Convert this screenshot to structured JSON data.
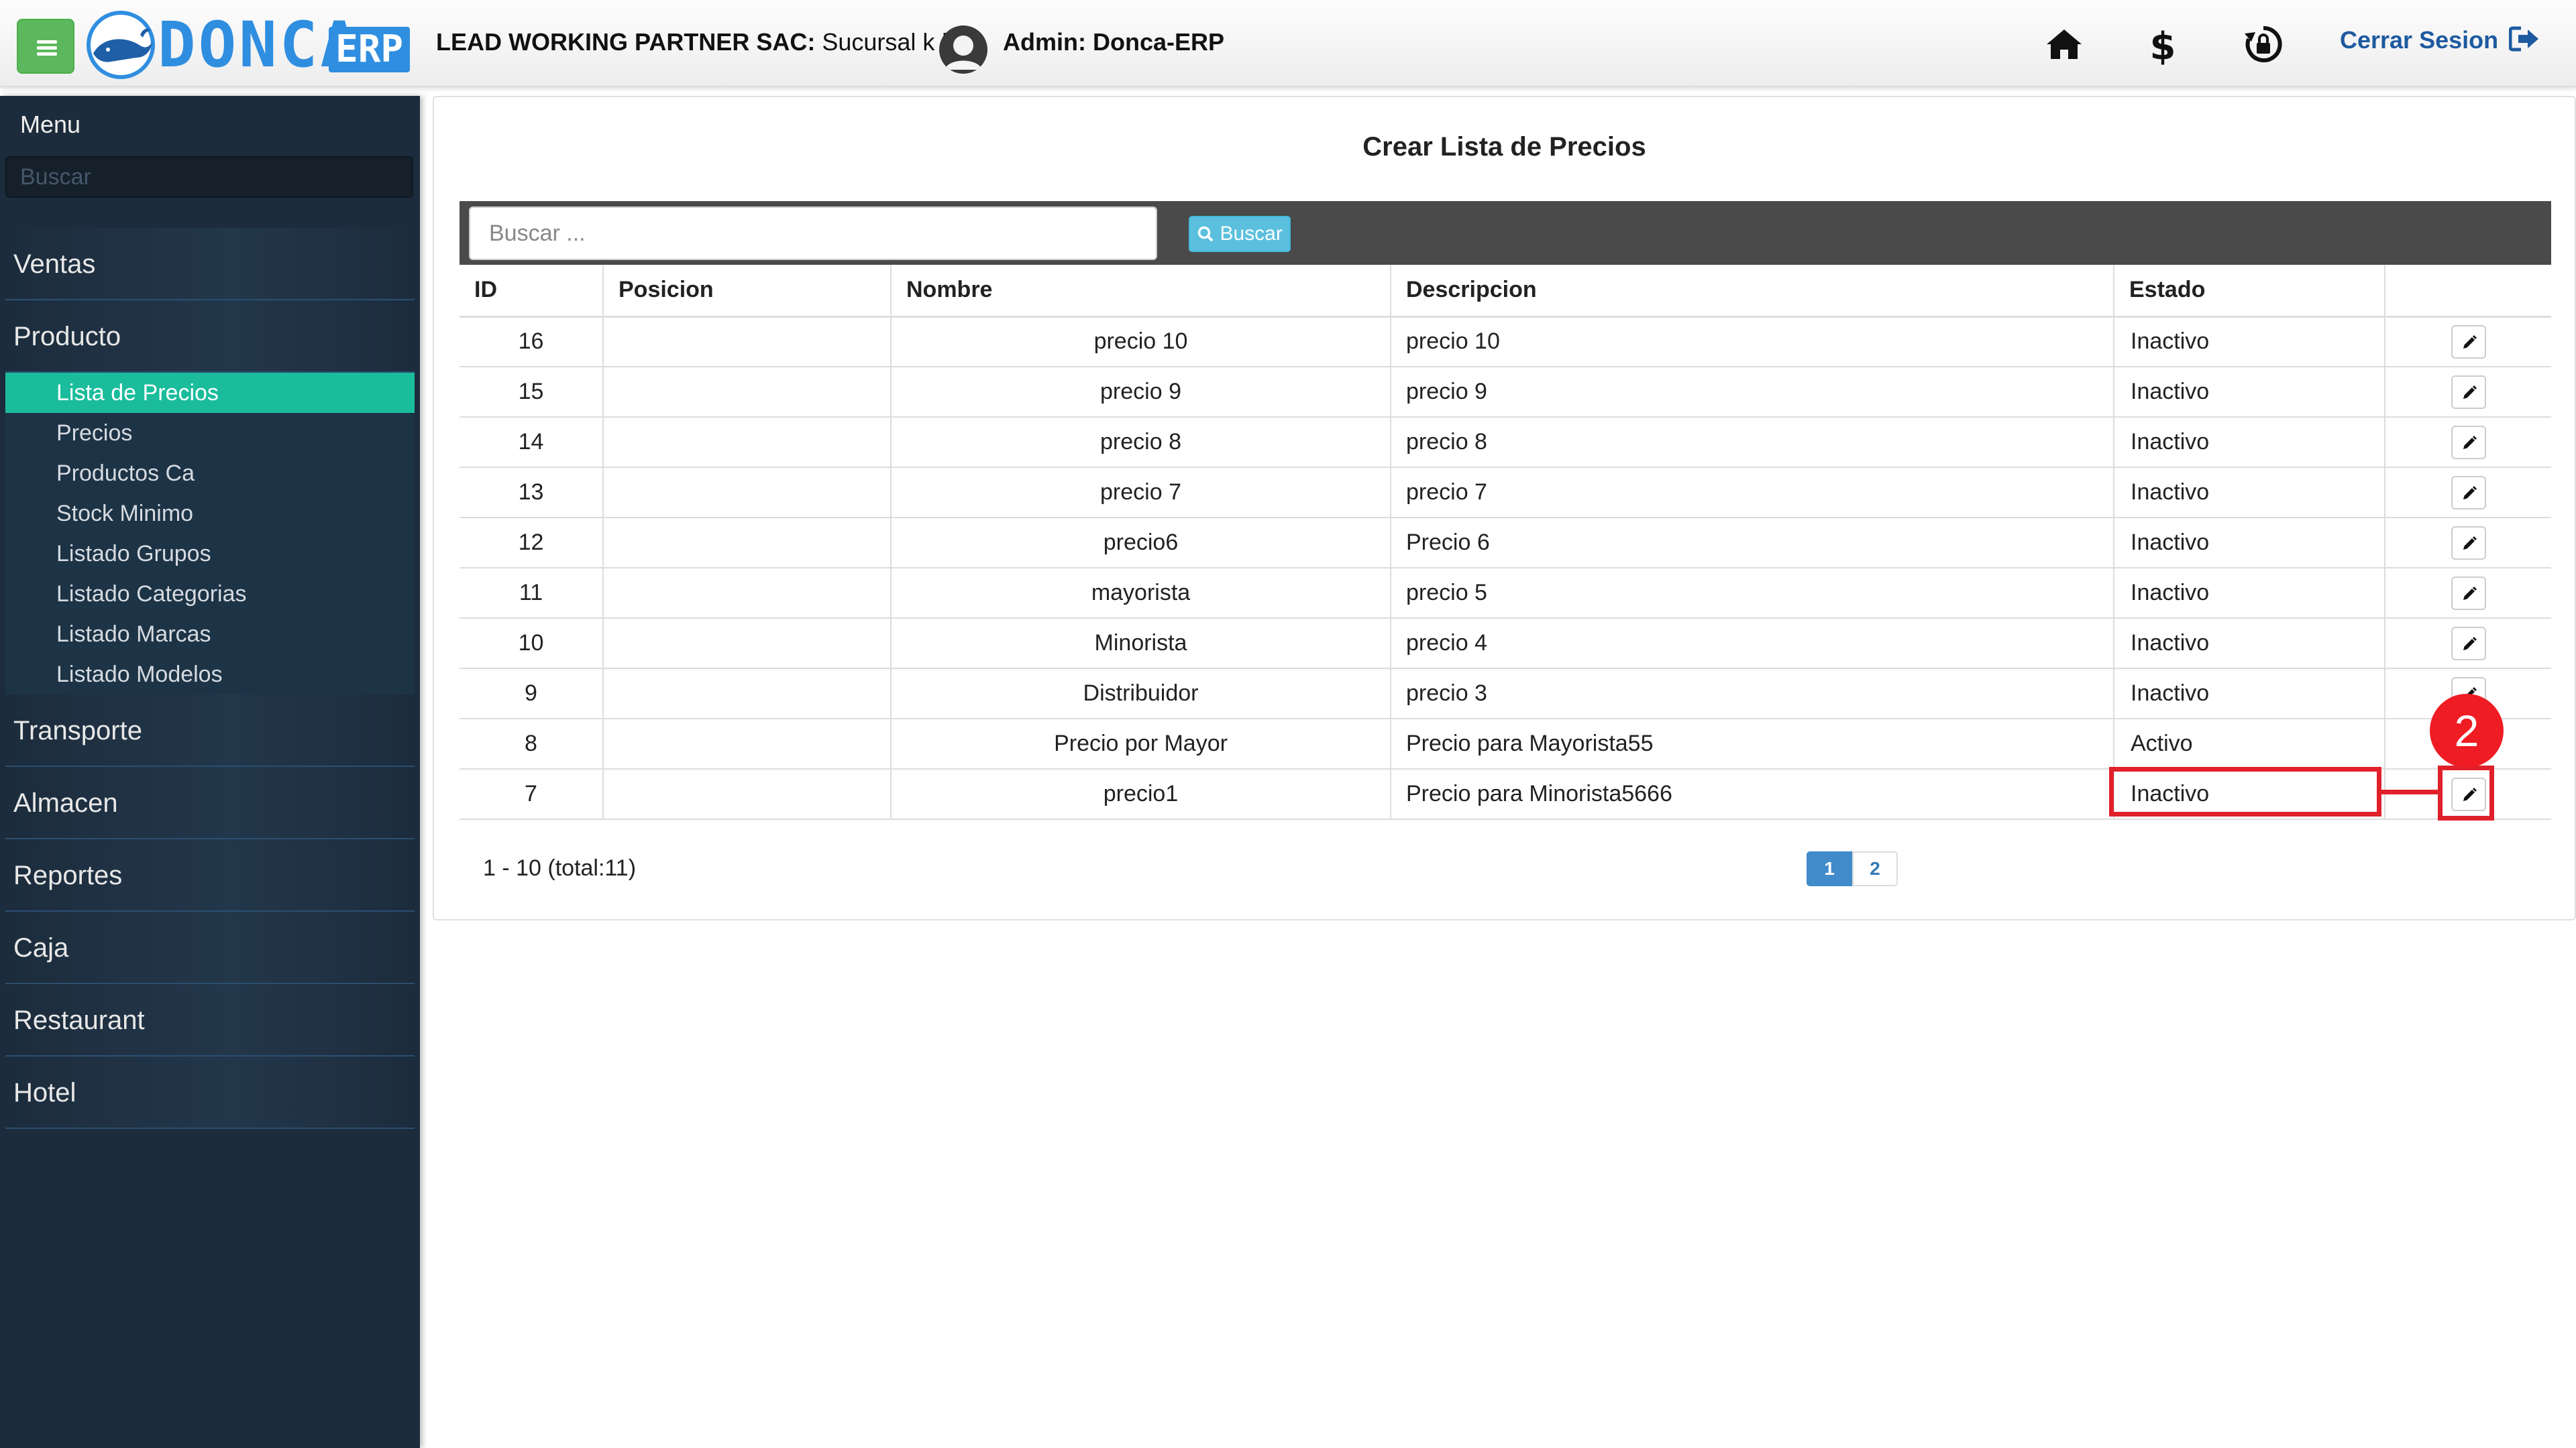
{
  "header": {
    "logo_text": "DONCA",
    "logo_badge": "ERP",
    "company_name": "LEAD WORKING PARTNER SAC:",
    "branch": " Sucursal k |",
    "admin": "Admin: Donca-ERP",
    "logout_label": "Cerrar Sesion",
    "icons": [
      "menu-icon",
      "home-icon",
      "dollar-icon",
      "refresh-lock-icon",
      "logout-icon"
    ]
  },
  "sidebar": {
    "menu_title": "Menu",
    "search_placeholder": "Buscar",
    "sections": [
      "Ventas",
      "Producto",
      "Transporte",
      "Almacen",
      "Reportes",
      "Caja",
      "Restaurant",
      "Hotel"
    ],
    "producto_items": [
      "Lista de Precios",
      "Precios",
      "Productos Ca",
      "Stock Minimo",
      "Listado Grupos",
      "Listado Categorias",
      "Listado Marcas",
      "Listado Modelos"
    ],
    "active_item": "Lista de Precios"
  },
  "main": {
    "title": "Crear Lista de Precios",
    "search_placeholder": "Buscar ...",
    "search_button": "Buscar",
    "columns": [
      "ID",
      "Posicion",
      "Nombre",
      "Descripcion",
      "Estado",
      ""
    ],
    "rows": [
      {
        "id": "16",
        "posicion": "",
        "nombre": "precio 10",
        "descripcion": "precio 10",
        "estado": "Inactivo"
      },
      {
        "id": "15",
        "posicion": "",
        "nombre": "precio 9",
        "descripcion": "precio 9",
        "estado": "Inactivo"
      },
      {
        "id": "14",
        "posicion": "",
        "nombre": "precio 8",
        "descripcion": "precio 8",
        "estado": "Inactivo"
      },
      {
        "id": "13",
        "posicion": "",
        "nombre": "precio 7",
        "descripcion": "precio 7",
        "estado": "Inactivo"
      },
      {
        "id": "12",
        "posicion": "",
        "nombre": "precio6",
        "descripcion": "Precio 6",
        "estado": "Inactivo"
      },
      {
        "id": "11",
        "posicion": "",
        "nombre": "mayorista",
        "descripcion": "precio 5",
        "estado": "Inactivo"
      },
      {
        "id": "10",
        "posicion": "",
        "nombre": "Minorista",
        "descripcion": "precio 4",
        "estado": "Inactivo"
      },
      {
        "id": "9",
        "posicion": "",
        "nombre": "Distribuidor",
        "descripcion": "precio 3",
        "estado": "Inactivo"
      },
      {
        "id": "8",
        "posicion": "",
        "nombre": "Precio por Mayor",
        "descripcion": "Precio para Mayorista55",
        "estado": "Activo"
      },
      {
        "id": "7",
        "posicion": "",
        "nombre": "precio1",
        "descripcion": "Precio para Minorista5666",
        "estado": "Inactivo"
      }
    ],
    "range_text": "1 - 10 (total:11)",
    "pages": [
      "1",
      "2"
    ],
    "current_page": "1"
  },
  "annotation": {
    "step_number": "2",
    "color": "#e0202a"
  },
  "colors": {
    "sidebar_bg": "#1c2c3c",
    "active_item": "#1abc9c",
    "menu_button": "#5cb85c",
    "brand_blue": "#2f8ee0",
    "search_button": "#5bc0de"
  }
}
